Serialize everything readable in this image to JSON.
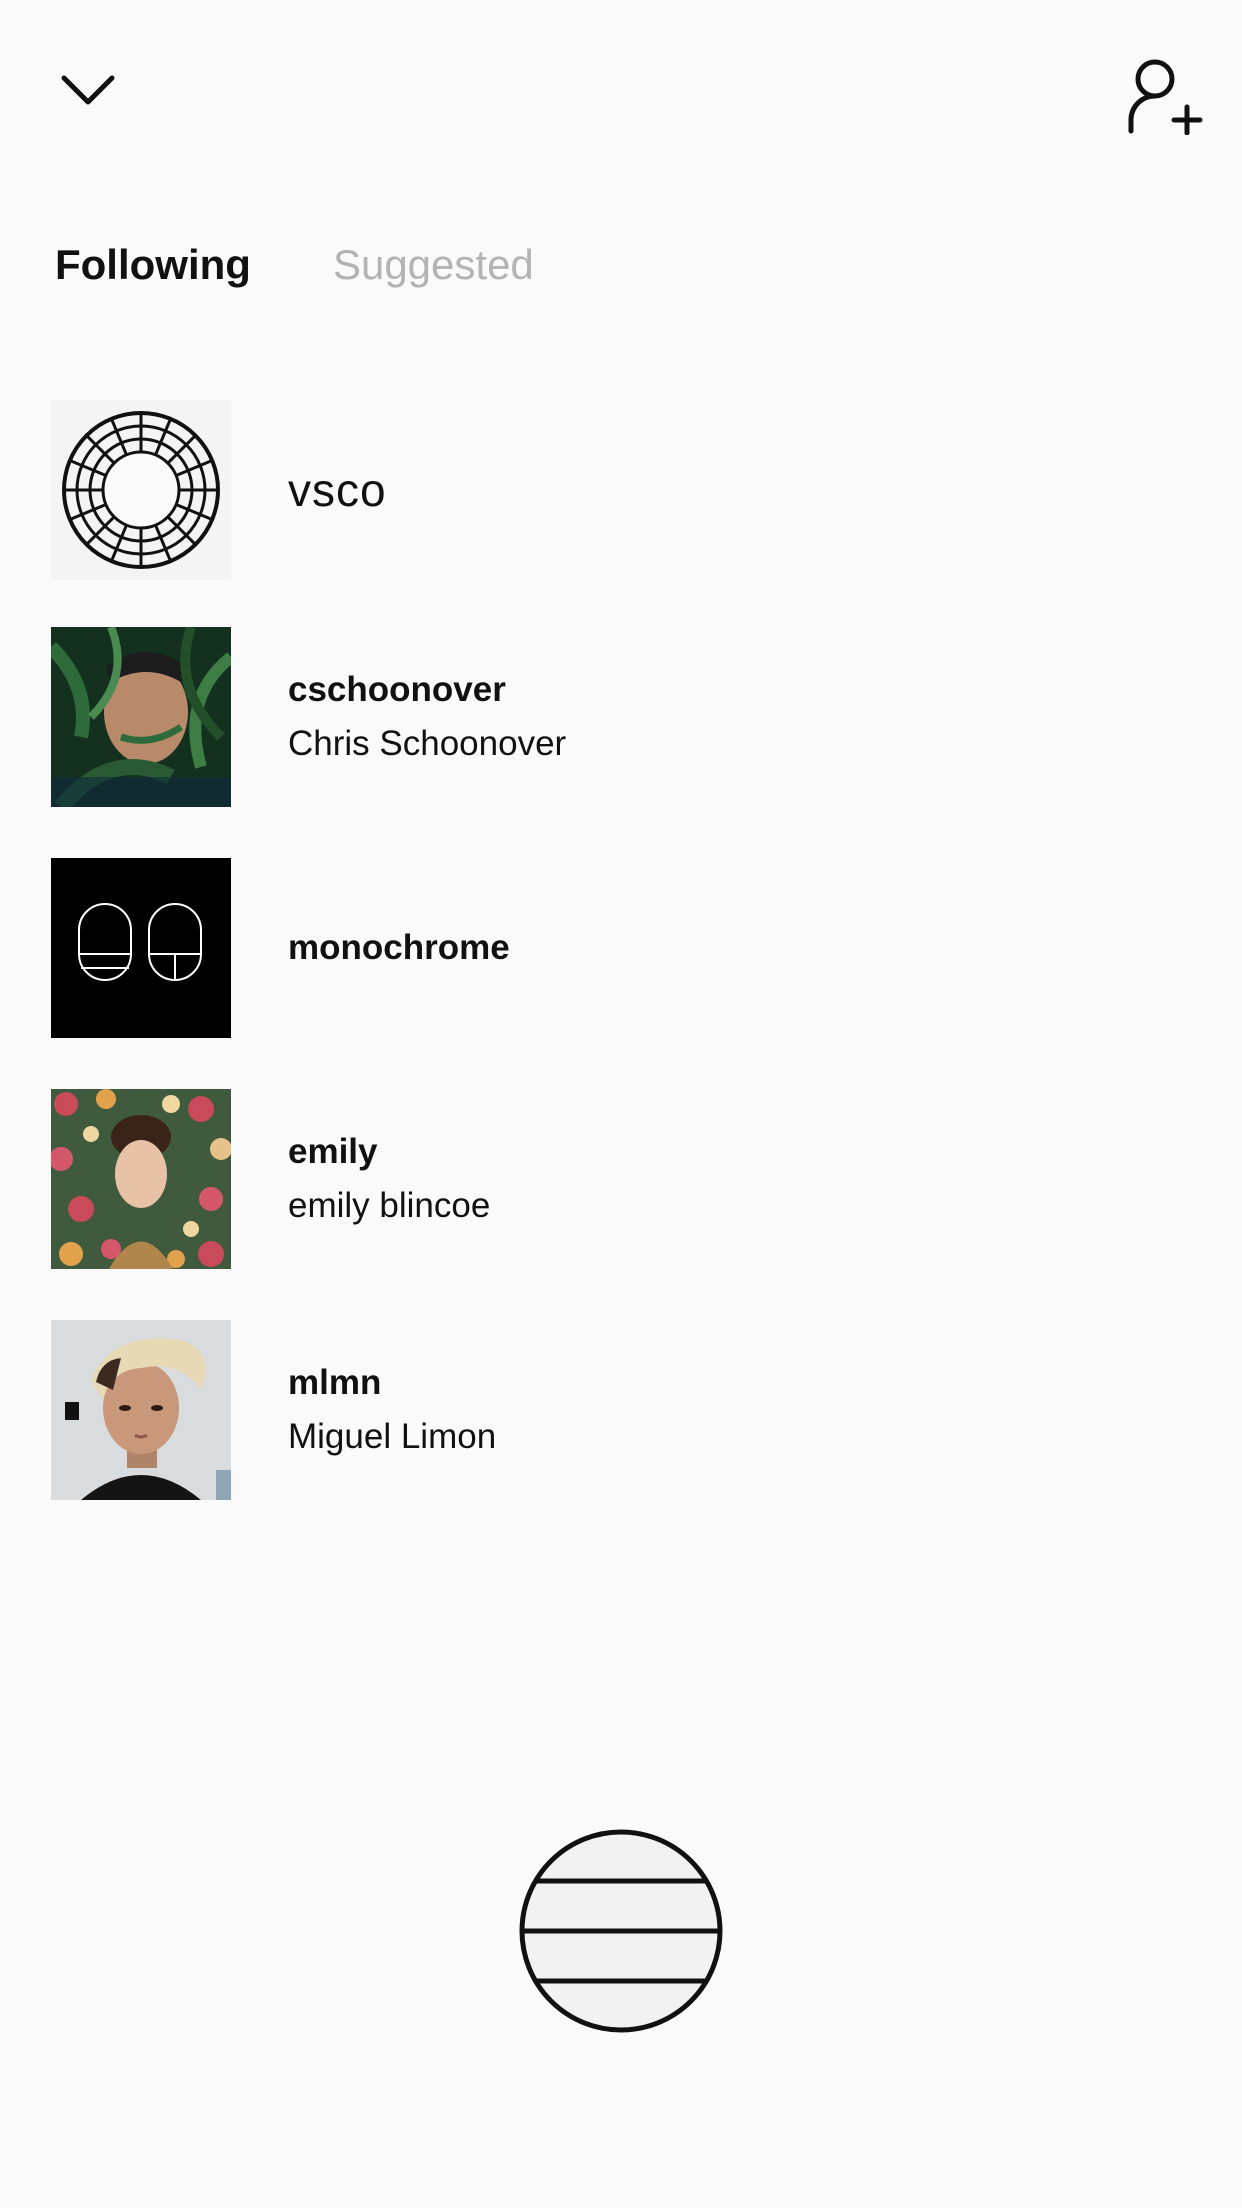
{
  "header": {
    "back_icon": "chevron-down-icon",
    "add_icon": "add-person-icon"
  },
  "tabs": [
    {
      "label": "Following",
      "active": true
    },
    {
      "label": "Suggested",
      "active": false
    }
  ],
  "following": [
    {
      "username": "vsco",
      "fullname": "",
      "avatar": "vsco-logo"
    },
    {
      "username": "cschoonover",
      "fullname": "Chris Schoonover",
      "avatar": "photo-man-leaves"
    },
    {
      "username": "monochrome",
      "fullname": "",
      "avatar": "monochrome-logo"
    },
    {
      "username": "emily",
      "fullname": "emily blincoe",
      "avatar": "photo-woman-flowers"
    },
    {
      "username": "mlmn",
      "fullname": "Miguel Limon",
      "avatar": "photo-man-portrait"
    }
  ],
  "colors": {
    "background": "#fafafa",
    "text": "#111111",
    "muted": "#b3b3b3"
  },
  "fab": {
    "icon": "menu-circle-icon"
  }
}
